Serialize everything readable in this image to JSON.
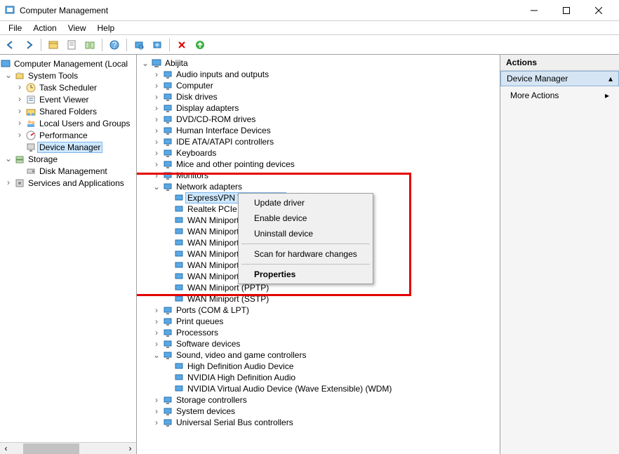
{
  "window": {
    "title": "Computer Management"
  },
  "menu": {
    "file": "File",
    "action": "Action",
    "view": "View",
    "help": "Help"
  },
  "left_tree": {
    "root": "Computer Management (Local",
    "system_tools": "System Tools",
    "task_scheduler": "Task Scheduler",
    "event_viewer": "Event Viewer",
    "shared_folders": "Shared Folders",
    "local_users": "Local Users and Groups",
    "performance": "Performance",
    "device_manager": "Device Manager",
    "storage": "Storage",
    "disk_management": "Disk Management",
    "services_apps": "Services and Applications"
  },
  "device_tree": {
    "root": "Abijita",
    "categories": [
      {
        "label": "Audio inputs and outputs",
        "expanded": false
      },
      {
        "label": "Computer",
        "expanded": false
      },
      {
        "label": "Disk drives",
        "expanded": false
      },
      {
        "label": "Display adapters",
        "expanded": false
      },
      {
        "label": "DVD/CD-ROM drives",
        "expanded": false
      },
      {
        "label": "Human Interface Devices",
        "expanded": false
      },
      {
        "label": "IDE ATA/ATAPI controllers",
        "expanded": false
      },
      {
        "label": "Keyboards",
        "expanded": false
      },
      {
        "label": "Mice and other pointing devices",
        "expanded": false
      },
      {
        "label": "Monitors",
        "expanded": false
      },
      {
        "label": "Network adapters",
        "expanded": true,
        "items": [
          "ExpressVPN TAP Adapter",
          "Realtek PCIe GbE",
          "WAN Miniport (I",
          "WAN Miniport (I",
          "WAN Miniport (I",
          "WAN Miniport (I",
          "WAN Miniport (I",
          "WAN Miniport (I",
          "WAN Miniport (PPTP)",
          "WAN Miniport (SSTP)"
        ]
      },
      {
        "label": "Ports (COM & LPT)",
        "expanded": false
      },
      {
        "label": "Print queues",
        "expanded": false
      },
      {
        "label": "Processors",
        "expanded": false
      },
      {
        "label": "Software devices",
        "expanded": false
      },
      {
        "label": "Sound, video and game controllers",
        "expanded": true,
        "items": [
          "High Definition Audio Device",
          "NVIDIA High Definition Audio",
          "NVIDIA Virtual Audio Device (Wave Extensible) (WDM)"
        ]
      },
      {
        "label": "Storage controllers",
        "expanded": false
      },
      {
        "label": "System devices",
        "expanded": false
      },
      {
        "label": "Universal Serial Bus controllers",
        "expanded": false
      }
    ]
  },
  "context_menu": {
    "update_driver": "Update driver",
    "enable_device": "Enable device",
    "uninstall_device": "Uninstall device",
    "scan_hardware": "Scan for hardware changes",
    "properties": "Properties"
  },
  "actions": {
    "header": "Actions",
    "section": "Device Manager",
    "more_actions": "More Actions"
  }
}
